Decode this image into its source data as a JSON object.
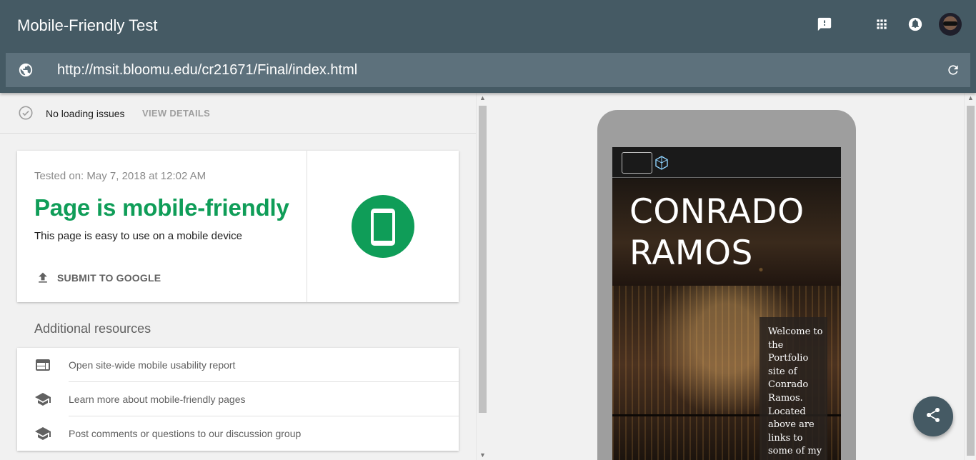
{
  "app": {
    "title": "Mobile-Friendly Test"
  },
  "header": {
    "icons": [
      "feedback-icon",
      "apps-grid-icon",
      "notifications-icon",
      "avatar"
    ],
    "url": "http://msit.bloomu.edu/cr21671/Final/index.html"
  },
  "status": {
    "text": "No loading issues",
    "details_label": "VIEW DETAILS"
  },
  "result": {
    "tested_on": "Tested on: May 7, 2018 at 12:02 AM",
    "verdict": "Page is mobile-friendly",
    "description": "This page is easy to use on a mobile device",
    "submit_label": "SUBMIT TO GOOGLE"
  },
  "resources": {
    "title": "Additional resources",
    "items": [
      {
        "label": "Open site-wide mobile usability report",
        "icon": "web-layout-icon"
      },
      {
        "label": "Learn more about mobile-friendly pages",
        "icon": "school-icon"
      },
      {
        "label": "Post comments or questions to our discussion group",
        "icon": "school-icon"
      }
    ]
  },
  "preview": {
    "hero_line1": "CONRADO",
    "hero_line2": "RAMOS",
    "welcome_text": "Welcome to the Portfolio site of Conrado Ramos. Located above are links to some of my"
  },
  "colors": {
    "header": "#455a64",
    "url_bar": "#5d717c",
    "success_green": "#0f9d58"
  }
}
